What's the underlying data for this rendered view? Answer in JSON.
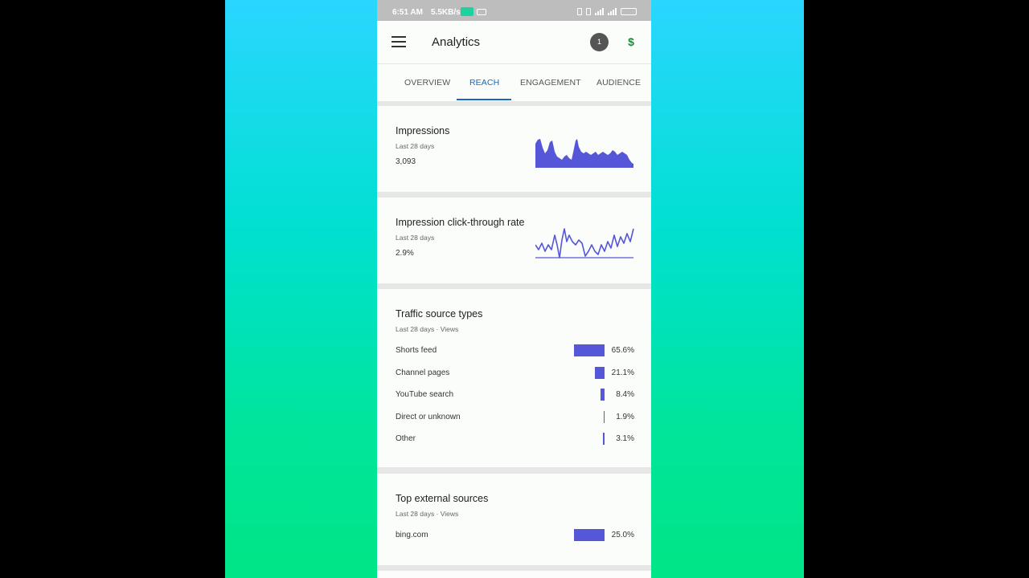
{
  "status_bar": {
    "time": "6:51 AM",
    "speed": "5.5KB/s"
  },
  "app_bar": {
    "title": "Analytics",
    "notification_count": "1",
    "menu_icon": "hamburger-menu-icon",
    "dollar_icon": "monetization-dollar-icon"
  },
  "tabs": [
    {
      "label": "OVERVIEW",
      "active": false
    },
    {
      "label": "REACH",
      "active": true
    },
    {
      "label": "ENGAGEMENT",
      "active": false
    },
    {
      "label": "AUDIENCE",
      "active": false
    }
  ],
  "impressions": {
    "title": "Impressions",
    "period": "Last 28 days",
    "value": "3,093"
  },
  "ctr": {
    "title": "Impression click-through rate",
    "period": "Last 28 days",
    "value": "2.9%"
  },
  "traffic_sources": {
    "title": "Traffic source types",
    "period": "Last 28 days · Views",
    "rows": [
      {
        "label": "Shorts feed",
        "pct": "65.6%",
        "value": 65.6
      },
      {
        "label": "Channel pages",
        "pct": "21.1%",
        "value": 21.1
      },
      {
        "label": "YouTube search",
        "pct": "8.4%",
        "value": 8.4
      },
      {
        "label": "Direct or unknown",
        "pct": "1.9%",
        "value": 1.9
      },
      {
        "label": "Other",
        "pct": "3.1%",
        "value": 3.1
      }
    ]
  },
  "external_sources": {
    "title": "Top external sources",
    "period": "Last 28 days · Views",
    "rows": [
      {
        "label": "bing.com",
        "pct": "25.0%",
        "value": 25.0
      }
    ]
  },
  "colors": {
    "accent": "#1668c0",
    "bar": "#5656d8",
    "background_top": "#2ad6ff",
    "background_bottom": "#00e586"
  }
}
